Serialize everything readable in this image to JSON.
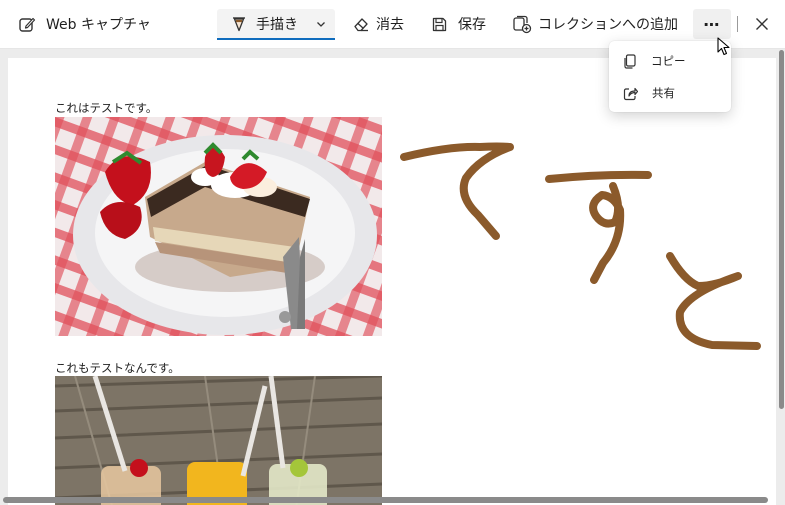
{
  "toolbar": {
    "app_title": "Web キャプチャ",
    "draw_label": "手描き",
    "erase_label": "消去",
    "save_label": "保存",
    "collection_label": "コレクションへの追加",
    "more_label": "⋯"
  },
  "menu": {
    "items": [
      {
        "label": "コピー",
        "icon": "copy-icon"
      },
      {
        "label": "共有",
        "icon": "share-icon"
      }
    ]
  },
  "content": {
    "caption1": "これはテストです。",
    "caption2": "これもテストなんです。",
    "handwriting": "てすと",
    "ink_color": "#8b5a2b"
  },
  "colors": {
    "accent": "#0f6cbd"
  }
}
